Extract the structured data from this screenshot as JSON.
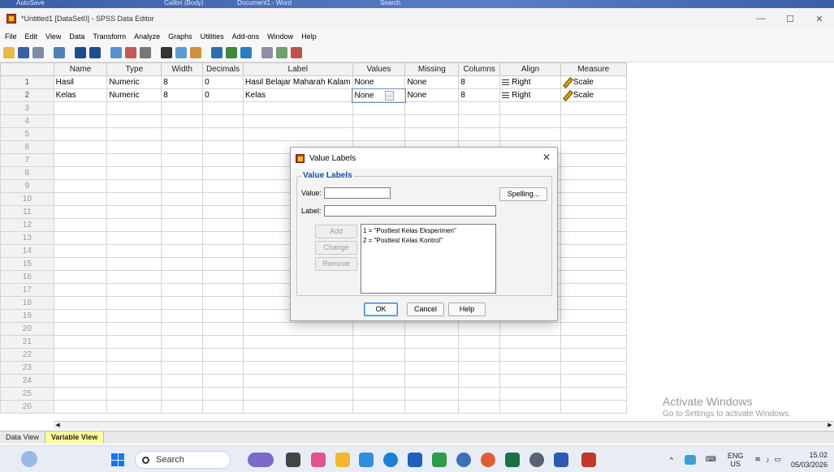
{
  "topstrip": {
    "left": "AutoSave",
    "mid": "Document1 - Word",
    "search": "Search",
    "font": "Calibri (Body)"
  },
  "window": {
    "title": "*Untitled1 [DataSet0] - SPSS Data Editor"
  },
  "menu": [
    "File",
    "Edit",
    "View",
    "Data",
    "Transform",
    "Analyze",
    "Graphs",
    "Utilities",
    "Add-ons",
    "Window",
    "Help"
  ],
  "columns": [
    "",
    "Name",
    "Type",
    "Width",
    "Decimals",
    "Label",
    "Values",
    "Missing",
    "Columns",
    "Align",
    "Measure"
  ],
  "rows": [
    {
      "num": "1",
      "name": "Hasil",
      "type": "Numeric",
      "width": "8",
      "decimals": "0",
      "label": "Hasil Belajar Maharah Kalam",
      "values": "None",
      "missing": "None",
      "columns": "8",
      "align": "Right",
      "measure": "Scale"
    },
    {
      "num": "2",
      "name": "Kelas",
      "type": "Numeric",
      "width": "8",
      "decimals": "0",
      "label": "Kelas",
      "values": "None",
      "missing": "None",
      "columns": "8",
      "align": "Right",
      "measure": "Scale"
    }
  ],
  "empty_rows": [
    "3",
    "4",
    "5",
    "6",
    "7",
    "8",
    "9",
    "10",
    "11",
    "12",
    "13",
    "14",
    "15",
    "16",
    "17",
    "18",
    "19",
    "20",
    "21",
    "22",
    "23",
    "24",
    "25",
    "26"
  ],
  "tabs": {
    "data_view": "Data View",
    "variable_view": "Variable View"
  },
  "watermark": {
    "line1": "Activate Windows",
    "line2": "Go to Settings to activate Windows."
  },
  "dialog": {
    "title": "Value Labels",
    "group": "Value Labels",
    "value_label": "Value:",
    "value": "",
    "label_label": "Label:",
    "label": "",
    "spelling": "Spelling...",
    "add": "Add",
    "change": "Change",
    "remove": "Remove",
    "list": [
      "1 = \"Posttest Kelas Eksperimen\"",
      "2 = \"Posttest Kelas Kontrol\""
    ],
    "ok": "OK",
    "cancel": "Cancel",
    "help": "Help"
  },
  "taskbar": {
    "search": "Search",
    "lang1": "ENG",
    "lang2": "US",
    "time": "15.02",
    "date": "05/03/2026"
  }
}
